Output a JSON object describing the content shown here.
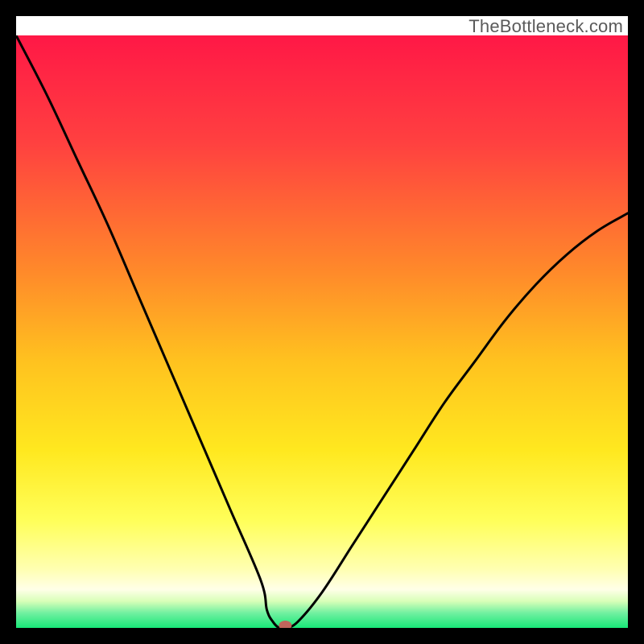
{
  "watermark": "TheBottleneck.com",
  "chart_data": {
    "type": "line",
    "title": "",
    "xlabel": "",
    "ylabel": "",
    "xlim": [
      0,
      100
    ],
    "ylim": [
      0,
      100
    ],
    "grid": false,
    "legend": false,
    "series": [
      {
        "name": "bottleneck-curve",
        "x": [
          0,
          5,
          10,
          15,
          20,
          25,
          30,
          35,
          40,
          41,
          42,
          43,
          44,
          46,
          50,
          55,
          60,
          65,
          70,
          75,
          80,
          85,
          90,
          95,
          100
        ],
        "values": [
          100,
          90,
          79,
          68,
          56,
          44,
          32,
          20,
          8,
          3,
          1,
          0,
          0,
          1,
          6,
          14,
          22,
          30,
          38,
          45,
          52,
          58,
          63,
          67,
          70
        ]
      }
    ],
    "marker": {
      "x": 44,
      "y": 0,
      "color": "#c0655c"
    },
    "gradient_stops": [
      {
        "offset": 0.0,
        "color": "#ff1846"
      },
      {
        "offset": 0.18,
        "color": "#ff4040"
      },
      {
        "offset": 0.4,
        "color": "#ff8a2a"
      },
      {
        "offset": 0.55,
        "color": "#ffc21f"
      },
      {
        "offset": 0.7,
        "color": "#ffe81f"
      },
      {
        "offset": 0.82,
        "color": "#ffff5a"
      },
      {
        "offset": 0.9,
        "color": "#ffffb0"
      },
      {
        "offset": 0.935,
        "color": "#ffffe8"
      },
      {
        "offset": 0.955,
        "color": "#d8ffb8"
      },
      {
        "offset": 0.975,
        "color": "#70f0a0"
      },
      {
        "offset": 1.0,
        "color": "#18e878"
      }
    ]
  }
}
